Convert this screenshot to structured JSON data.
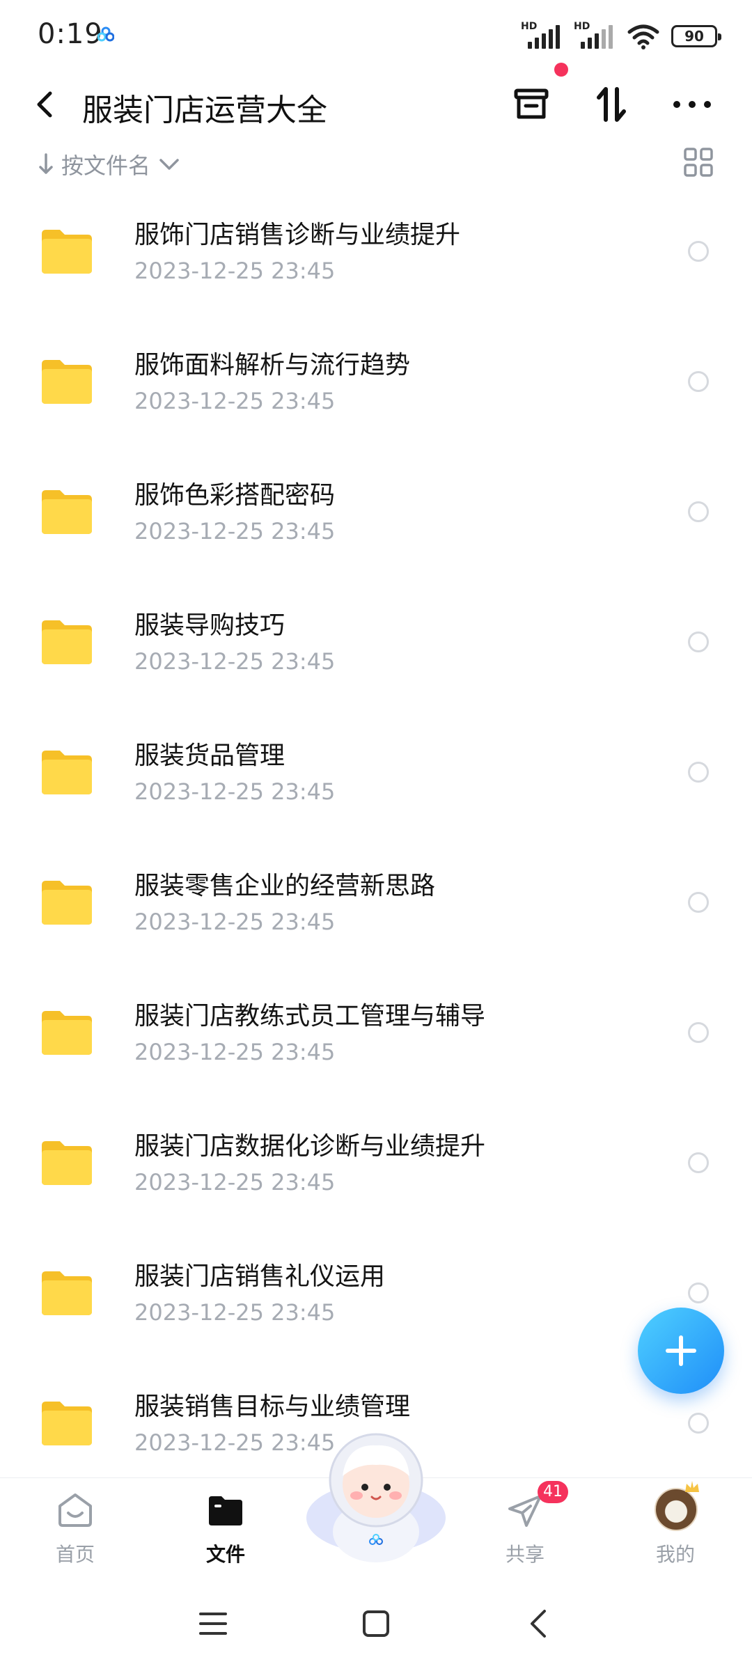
{
  "status_bar": {
    "time": "0:19",
    "signal1_label": "HD",
    "signal2_label": "HD",
    "battery": "90"
  },
  "header": {
    "title": "服装门店运营大全"
  },
  "sort": {
    "label": "按文件名"
  },
  "files": [
    {
      "name": "服饰门店销售诊断与业绩提升",
      "date": "2023-12-25  23:45"
    },
    {
      "name": "服饰面料解析与流行趋势",
      "date": "2023-12-25  23:45"
    },
    {
      "name": "服饰色彩搭配密码",
      "date": "2023-12-25  23:45"
    },
    {
      "name": "服装导购技巧",
      "date": "2023-12-25  23:45"
    },
    {
      "name": "服装货品管理",
      "date": "2023-12-25  23:45"
    },
    {
      "name": "服装零售企业的经营新思路",
      "date": "2023-12-25  23:45"
    },
    {
      "name": "服装门店教练式员工管理与辅导",
      "date": "2023-12-25  23:45"
    },
    {
      "name": "服装门店数据化诊断与业绩提升",
      "date": "2023-12-25  23:45"
    },
    {
      "name": "服装门店销售礼仪运用",
      "date": "2023-12-25  23:45"
    },
    {
      "name": "服装销售目标与业绩管理",
      "date": "2023-12-25  23:45"
    }
  ],
  "nav": {
    "home": "首页",
    "files": "文件",
    "share": "共享",
    "share_badge": "41",
    "mine": "我的"
  },
  "colors": {
    "accent": "#1f8ef8",
    "folder": "#ffd43b",
    "badge": "#f5325c"
  }
}
